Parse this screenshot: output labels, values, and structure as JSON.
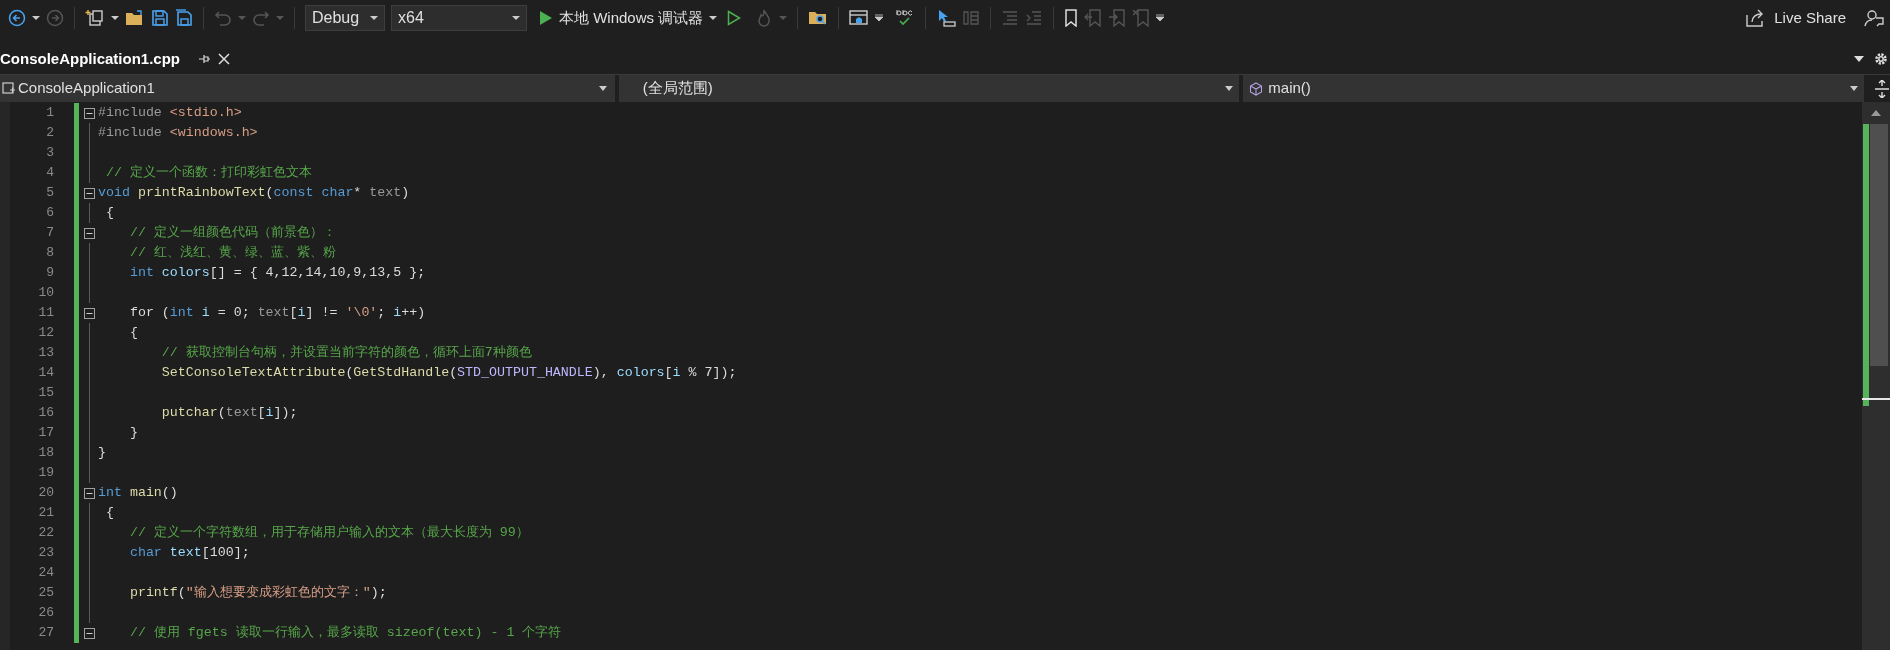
{
  "toolbar": {
    "configuration": "Debug",
    "platform": "x64",
    "run_label": "本地 Windows 调试器",
    "live_share": "Live Share"
  },
  "tabs": [
    {
      "label": "ConsoleApplication1.cpp",
      "selected": true
    }
  ],
  "navigation": {
    "project": "ConsoleApplication1",
    "scope": "(全局范围)",
    "member": "main()"
  },
  "editor": {
    "lines": [
      {
        "number": "1",
        "fold": true,
        "tokens": [
          {
            "kind": "inc",
            "text": "#include"
          },
          {
            "kind": "str",
            "text": " <stdio.h>"
          }
        ]
      },
      {
        "number": "2",
        "fold": false,
        "tokens": [
          {
            "kind": "inc",
            "text": "#include"
          },
          {
            "kind": "str",
            "text": " <windows.h>"
          }
        ]
      },
      {
        "number": "3",
        "fold": false
      },
      {
        "number": "4",
        "fold": false,
        "tokens": [
          {
            "kind": "cm",
            "text": " // 定义一个函数：打印彩虹色文本"
          }
        ]
      },
      {
        "number": "5",
        "fold": true,
        "tokens": [
          {
            "kind": "kw",
            "text": "void "
          },
          {
            "kind": "fn",
            "text": "printRainbowText"
          },
          {
            "kind": "plain",
            "text": "("
          },
          {
            "kind": "kw",
            "text": "const char"
          },
          {
            "kind": "plain",
            "text": "* "
          },
          {
            "kind": "param",
            "text": "text"
          },
          {
            "kind": "plain",
            "text": ")"
          }
        ]
      },
      {
        "number": "6",
        "fold": false,
        "tokens": [
          {
            "kind": "plain",
            "text": " {"
          }
        ]
      },
      {
        "number": "7",
        "fold": true,
        "tokens": [
          {
            "kind": "cm",
            "text": "    // 定义一组颜色代码（前景色）："
          }
        ]
      },
      {
        "number": "8",
        "fold": false,
        "tokens": [
          {
            "kind": "cm",
            "text": "    // 红、浅红、黄、绿、蓝、紫、粉"
          }
        ]
      },
      {
        "number": "9",
        "fold": false,
        "tokens": [
          {
            "kind": "kw",
            "text": "    int "
          },
          {
            "kind": "var",
            "text": "colors"
          },
          {
            "kind": "plain",
            "text": "[] = { 4,12,14,10,9,13,5 };"
          }
        ]
      },
      {
        "number": "10",
        "fold": false
      },
      {
        "number": "11",
        "fold": true,
        "tokens": [
          {
            "kind": "plain",
            "text": "    for ("
          },
          {
            "kind": "kw",
            "text": "int "
          },
          {
            "kind": "var",
            "text": "i"
          },
          {
            "kind": "plain",
            "text": " = 0; "
          },
          {
            "kind": "param",
            "text": "text"
          },
          {
            "kind": "plain",
            "text": "["
          },
          {
            "kind": "var",
            "text": "i"
          },
          {
            "kind": "plain",
            "text": "] != "
          },
          {
            "kind": "str",
            "text": "'\\0'"
          },
          {
            "kind": "plain",
            "text": "; "
          },
          {
            "kind": "var",
            "text": "i"
          },
          {
            "kind": "plain",
            "text": "++)"
          }
        ]
      },
      {
        "number": "12",
        "fold": false,
        "tokens": [
          {
            "kind": "plain",
            "text": "    {"
          }
        ]
      },
      {
        "number": "13",
        "fold": false,
        "tokens": [
          {
            "kind": "cm",
            "text": "        // 获取控制台句柄，并设置当前字符的颜色，循环上面7种颜色"
          }
        ]
      },
      {
        "number": "14",
        "fold": false,
        "tokens": [
          {
            "kind": "fn",
            "text": "        SetConsoleTextAttribute"
          },
          {
            "kind": "plain",
            "text": "("
          },
          {
            "kind": "fn",
            "text": "GetStdHandle"
          },
          {
            "kind": "plain",
            "text": "("
          },
          {
            "kind": "mac",
            "text": "STD_OUTPUT_HANDLE"
          },
          {
            "kind": "plain",
            "text": "), "
          },
          {
            "kind": "var",
            "text": "colors"
          },
          {
            "kind": "plain",
            "text": "["
          },
          {
            "kind": "var",
            "text": "i"
          },
          {
            "kind": "plain",
            "text": " % 7]);"
          }
        ]
      },
      {
        "number": "15",
        "fold": false
      },
      {
        "number": "16",
        "fold": false,
        "tokens": [
          {
            "kind": "fn",
            "text": "        putchar"
          },
          {
            "kind": "plain",
            "text": "("
          },
          {
            "kind": "param",
            "text": "text"
          },
          {
            "kind": "plain",
            "text": "["
          },
          {
            "kind": "var",
            "text": "i"
          },
          {
            "kind": "plain",
            "text": "]);"
          }
        ]
      },
      {
        "number": "17",
        "fold": false,
        "tokens": [
          {
            "kind": "plain",
            "text": "    }"
          }
        ]
      },
      {
        "number": "18",
        "fold": false,
        "tokens": [
          {
            "kind": "plain",
            "text": "}"
          }
        ]
      },
      {
        "number": "19",
        "fold": false
      },
      {
        "number": "20",
        "fold": true,
        "tokens": [
          {
            "kind": "kw",
            "text": "int "
          },
          {
            "kind": "fn",
            "text": "main"
          },
          {
            "kind": "plain",
            "text": "()"
          }
        ]
      },
      {
        "number": "21",
        "fold": false,
        "tokens": [
          {
            "kind": "plain",
            "text": " {"
          }
        ]
      },
      {
        "number": "22",
        "fold": false,
        "tokens": [
          {
            "kind": "cm",
            "text": "    // 定义一个字符数组，用于存储用户输入的文本（最大长度为 99）"
          }
        ]
      },
      {
        "number": "23",
        "fold": false,
        "tokens": [
          {
            "kind": "kw",
            "text": "    char "
          },
          {
            "kind": "var",
            "text": "text"
          },
          {
            "kind": "plain",
            "text": "[100];"
          }
        ]
      },
      {
        "number": "24",
        "fold": false
      },
      {
        "number": "25",
        "fold": false,
        "tokens": [
          {
            "kind": "fn",
            "text": "    printf"
          },
          {
            "kind": "plain",
            "text": "("
          },
          {
            "kind": "str",
            "text": "\"输入想要变成彩虹色的文字：\""
          },
          {
            "kind": "plain",
            "text": ");"
          }
        ]
      },
      {
        "number": "26",
        "fold": false
      },
      {
        "number": "27",
        "fold": true,
        "tokens": [
          {
            "kind": "cm",
            "text": "    // 使用 fgets 读取一行输入，最多读取 sizeof(text) - 1 个字符"
          }
        ]
      }
    ]
  }
}
